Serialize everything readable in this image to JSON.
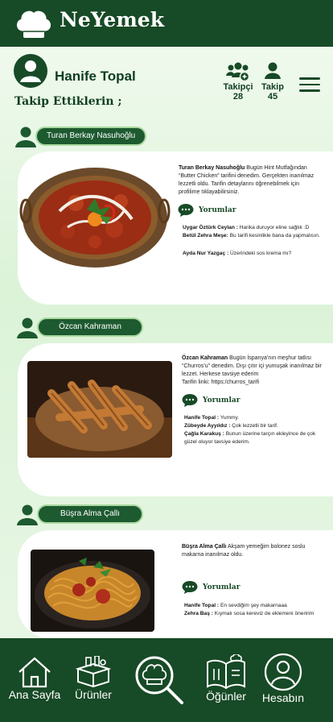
{
  "app": {
    "title": "NeYemek"
  },
  "profile": {
    "name": "Hanife Topal",
    "followers_label": "Takipçi",
    "followers_count": "28",
    "following_label": "Takip",
    "following_count": "45"
  },
  "section_title": "Takip Ettiklerin ;",
  "comments_label": "Yorumlar",
  "posts": [
    {
      "author": "Turan Berkay Nasuhoğlu",
      "text": "Bugün Hint Mutfağından “Butter Chicken” tarifini denedim. Gerçekten inanılmaz lezzetli oldu. Tarifin detaylarını öğrenebilmek için profilime tıklayabilirsiniz.",
      "comments": [
        {
          "user": "Uygar Öztürk Ceylan :",
          "text": "Harika duruyor eline sağlık :D"
        },
        {
          "user": "Betül Zehra Meşe:",
          "text": "Bu tarifi kesinlikle bana da yapmalısın."
        },
        {
          "user": "Ayda Nur Yazgaç :",
          "text": "Üzerindeki sos krema mı?"
        }
      ]
    },
    {
      "author": "Özcan Kahraman",
      "text": "Bugün İspanya’nın meşhur tatlısı “Churros’u” denedim. Dışı çıtır içi yumuşak inanılmaz bir lezzet. Herkese tavsiye ederim",
      "link": "Tarifin linki: https:/churros_tarifi",
      "comments": [
        {
          "user": "Hanife Topal :",
          "text": "Yummy."
        },
        {
          "user": "Zübeyde Ayyıldız :",
          "text": "Çok lezzetli bir tarif."
        },
        {
          "user": "Çağla Karakuş :",
          "text": "Bunun üzerine tarçın ekleyince de çok güzel oluyor tavsiye ederim."
        }
      ]
    },
    {
      "author": "Büşra Alma Çallı",
      "text": "Akşam yemeğim bolonez soslu makarna inanılmaz oldu.",
      "comments": [
        {
          "user": "Hanife Topal :",
          "text": "En sevdiğim şey makarnaaa"
        },
        {
          "user": "Zehra Baş :",
          "text": "Kıymalı sosa kereviz de eklemeni öneririm"
        }
      ]
    }
  ],
  "nav": {
    "home": "Ana Sayfa",
    "products": "Ürünler",
    "meals": "Öğünler",
    "account": "Hesabın"
  },
  "icons": {
    "logo": "chef-hat-icon",
    "search": "chef-search-icon",
    "comments": "speech-bubble-icon"
  },
  "colors": {
    "primary": "#174a26",
    "pill": "#1d5a30",
    "background": "#dcf3d8"
  }
}
